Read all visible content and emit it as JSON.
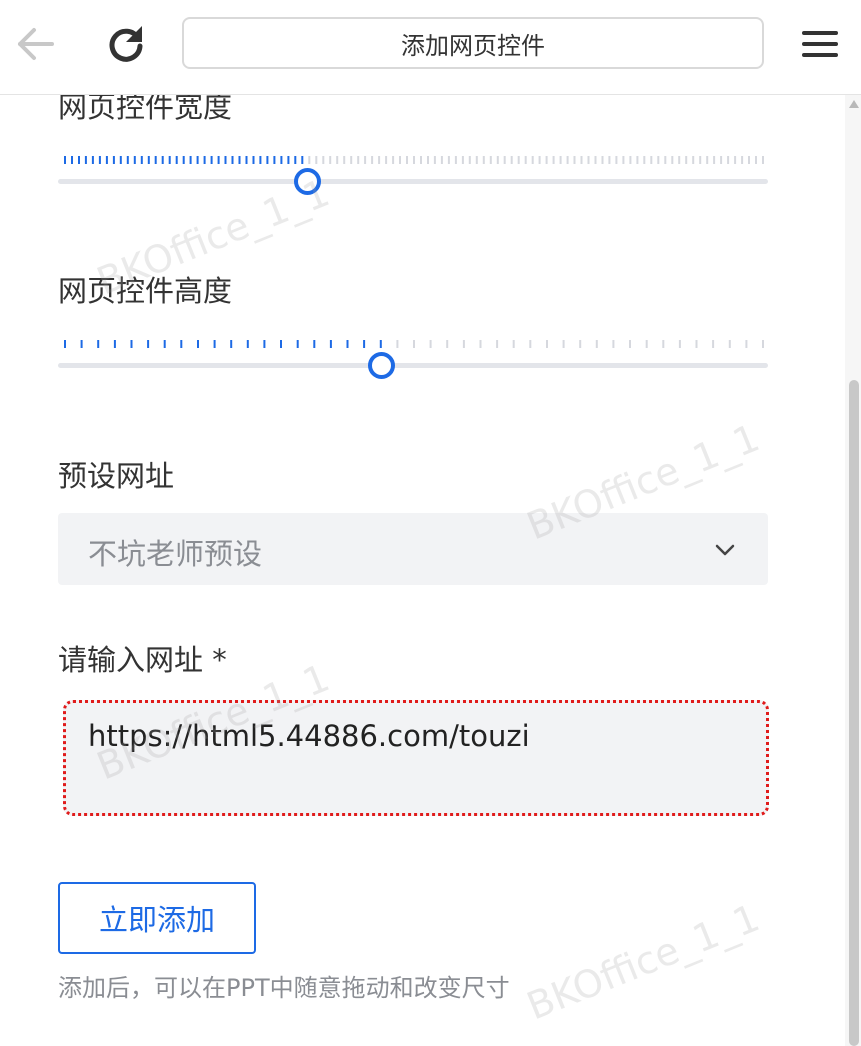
{
  "topbar": {
    "back_icon": "arrow-left-icon",
    "reload_icon": "reload-icon",
    "title": "添加网页控件",
    "menu_icon": "hamburger-menu-icon"
  },
  "width_field": {
    "label": "网页控件宽度",
    "value_fraction": 0.35
  },
  "height_field": {
    "label": "网页控件高度",
    "value_fraction": 0.455
  },
  "preset": {
    "label": "预设网址",
    "selected": "不坑老师预设",
    "icon": "chevron-down-icon"
  },
  "url": {
    "label": "请输入网址 *",
    "value": "https://html5.44886.com/touzi"
  },
  "add_button": {
    "label": "立即添加"
  },
  "hint": "添加后，可以在PPT中随意拖动和改变尺寸",
  "watermark": "BKOffice_1_1",
  "colors": {
    "accent": "#1d6ae5",
    "input_bg": "#f2f3f5",
    "highlight_border": "#e01b1b"
  }
}
